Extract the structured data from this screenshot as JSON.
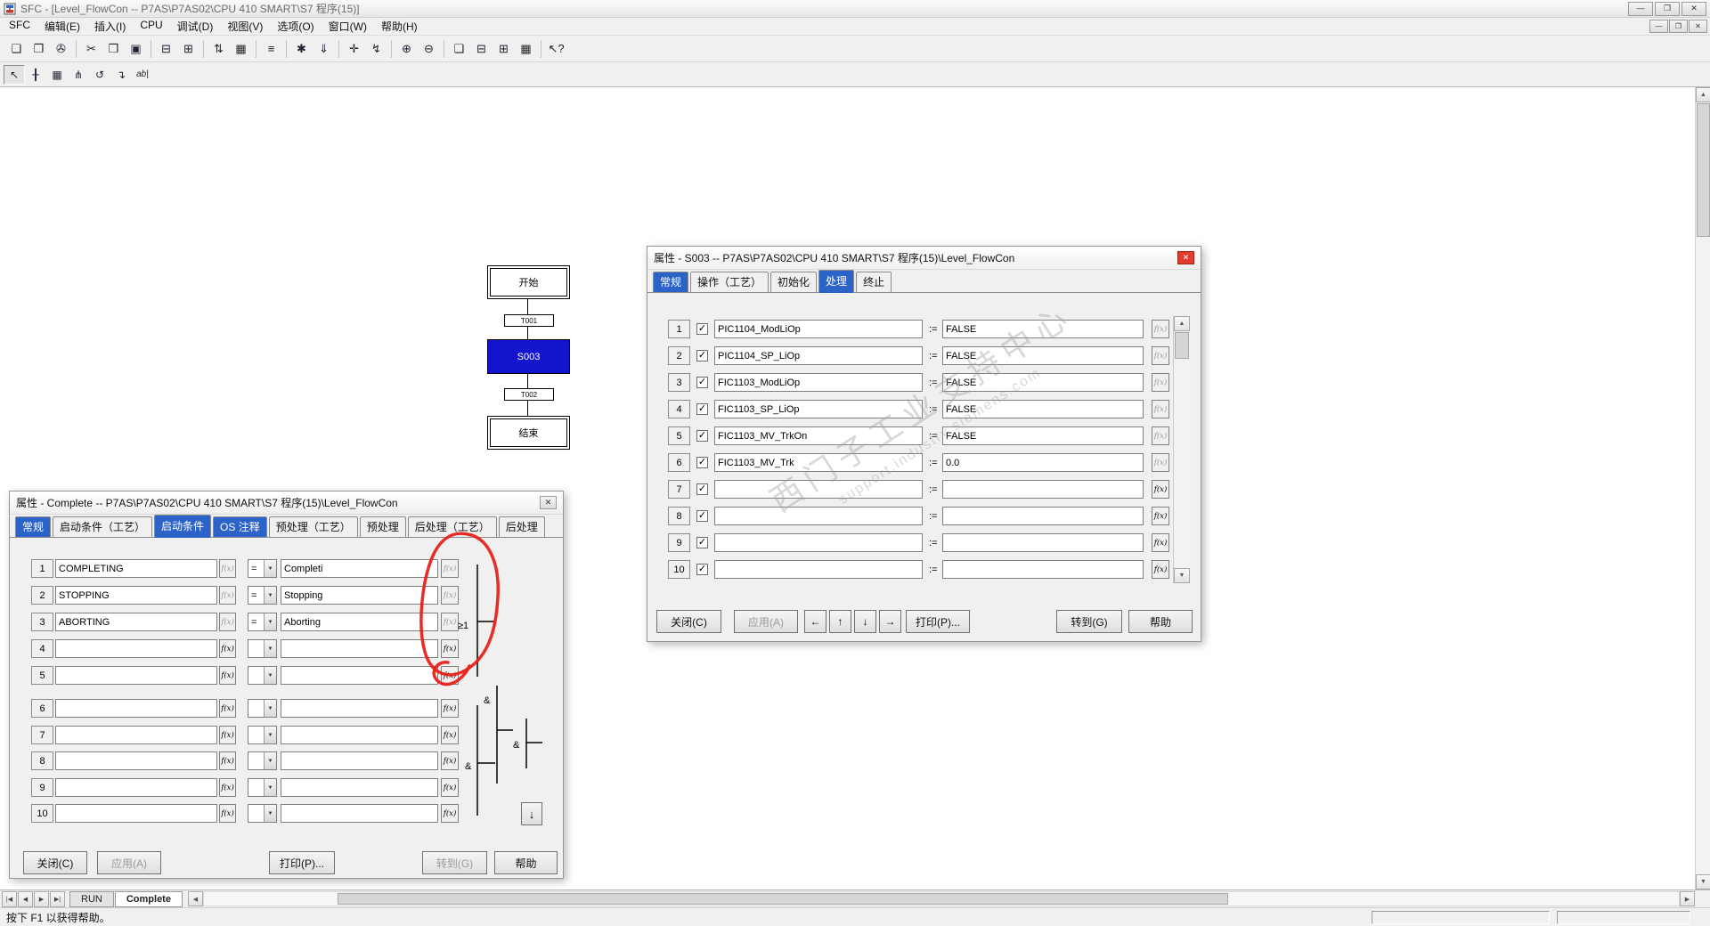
{
  "colors": {
    "tab_blue": "#2b63c8",
    "step_selected_blue": "#1414cf",
    "annotation_red": "#e8211a",
    "close_red": "#e23c2e"
  },
  "glyphs": {
    "close": "✕",
    "minimize": "—",
    "maximize": "❐",
    "restore": "❐",
    "check": "✓",
    "combo_arrow": "▼",
    "up": "▲",
    "down": "▼",
    "left": "◀",
    "right": "▶"
  },
  "titlebar": {
    "title": "SFC - [Level_FlowCon -- P7AS\\P7AS02\\CPU 410 SMART\\S7 程序(15)]"
  },
  "menubar": {
    "items": [
      "SFC",
      "编辑(E)",
      "插入(I)",
      "CPU",
      "调试(D)",
      "视图(V)",
      "选项(O)",
      "窗口(W)",
      "帮助(H)"
    ]
  },
  "toolbar": [
    {
      "name": "new-icon",
      "glyph": "❏"
    },
    {
      "name": "open-icon",
      "glyph": "❐"
    },
    {
      "name": "print-icon",
      "glyph": "✇"
    },
    {
      "sep": true
    },
    {
      "name": "cut-icon",
      "glyph": "✂"
    },
    {
      "name": "copy-icon",
      "glyph": "❒"
    },
    {
      "name": "paste-icon",
      "glyph": "▣"
    },
    {
      "sep": true
    },
    {
      "name": "sheet-view-icon",
      "glyph": "⊟"
    },
    {
      "name": "overview-icon",
      "glyph": "⊞"
    },
    {
      "sep": true
    },
    {
      "name": "run-sequence-icon",
      "glyph": "⇅"
    },
    {
      "name": "chart-icon",
      "glyph": "▦"
    },
    {
      "sep": true
    },
    {
      "name": "catalog-icon",
      "glyph": "≡"
    },
    {
      "sep": true
    },
    {
      "name": "compile-icon",
      "glyph": "✱"
    },
    {
      "name": "download-icon",
      "glyph": "⇓"
    },
    {
      "sep": true
    },
    {
      "name": "crosshair-icon",
      "glyph": "✛"
    },
    {
      "name": "test-mode-icon",
      "glyph": "↯"
    },
    {
      "sep": true
    },
    {
      "name": "zoom-in-icon",
      "glyph": "⊕"
    },
    {
      "name": "zoom-out-icon",
      "glyph": "⊖"
    },
    {
      "sep": true
    },
    {
      "name": "cascade-windows-icon",
      "glyph": "❏"
    },
    {
      "name": "tile-horizontal-icon",
      "glyph": "⊟"
    },
    {
      "name": "tile-vertical-icon",
      "glyph": "⊞"
    },
    {
      "name": "arrange-icons-icon",
      "glyph": "▦"
    },
    {
      "sep": true
    },
    {
      "name": "context-help-icon",
      "glyph": "↖?"
    }
  ],
  "sfc_toolbar": [
    {
      "name": "select-tool-icon",
      "glyph": "↖",
      "pressed": true
    },
    {
      "name": "insert-step-transition-icon",
      "glyph": "╂"
    },
    {
      "name": "insert-simultaneous-branch-icon",
      "glyph": "▦"
    },
    {
      "name": "insert-alternative-branch-icon",
      "glyph": "⋔"
    },
    {
      "name": "insert-loop-icon",
      "glyph": "↺"
    },
    {
      "name": "insert-jump-icon",
      "glyph": "↴"
    },
    {
      "name": "text-tool-icon",
      "glyph": "ab|"
    }
  ],
  "chart": {
    "start": "开始",
    "transition1": "T001",
    "step": "S003",
    "transition2": "T002",
    "end": "结束"
  },
  "fx_label": "f(x)",
  "transition_dialog": {
    "title": "属性 -  Complete -- P7AS\\P7AS02\\CPU 410 SMART\\S7 程序(15)\\Level_FlowCon",
    "tabs": [
      {
        "label": "常规",
        "style": "blue"
      },
      {
        "label": "启动条件（工艺）",
        "style": "plain"
      },
      {
        "label": "启动条件",
        "style": "active"
      },
      {
        "label": "OS 注释",
        "style": "blue"
      },
      {
        "label": "预处理（工艺）",
        "style": "plain"
      },
      {
        "label": "预处理",
        "style": "plain"
      },
      {
        "label": "后处理（工艺）",
        "style": "plain"
      },
      {
        "label": "后处理",
        "style": "plain"
      }
    ],
    "rows": [
      {
        "num": "1",
        "left": "COMPLETING",
        "op": "=",
        "right": "Completi"
      },
      {
        "num": "2",
        "left": "STOPPING",
        "op": "=",
        "right": "Stopping"
      },
      {
        "num": "3",
        "left": "ABORTING",
        "op": "=",
        "right": "Aborting"
      },
      {
        "num": "4",
        "left": "",
        "op": "",
        "right": ""
      },
      {
        "num": "5",
        "left": "",
        "op": "",
        "right": ""
      },
      {
        "num": "6",
        "left": "",
        "op": "",
        "right": ""
      },
      {
        "num": "7",
        "left": "",
        "op": "",
        "right": ""
      },
      {
        "num": "8",
        "left": "",
        "op": "",
        "right": ""
      },
      {
        "num": "9",
        "left": "",
        "op": "",
        "right": ""
      },
      {
        "num": "10",
        "left": "",
        "op": "",
        "right": ""
      }
    ],
    "gates": {
      "or": "≥1",
      "and1": "&",
      "and2": "&",
      "and3": "&",
      "result_arrow": "↓"
    },
    "buttons": {
      "close": "关闭(C)",
      "apply": "应用(A)",
      "print": "打印(P)...",
      "goto": "转到(G)",
      "help": "帮助"
    }
  },
  "step_dialog": {
    "title": "属性 -  S003 -- P7AS\\P7AS02\\CPU 410 SMART\\S7 程序(15)\\Level_FlowCon",
    "tabs": [
      {
        "label": "常规",
        "style": "blue"
      },
      {
        "label": "操作（工艺）",
        "style": "plain"
      },
      {
        "label": "初始化",
        "style": "plain"
      },
      {
        "label": "处理",
        "style": "active"
      },
      {
        "label": "终止",
        "style": "plain"
      }
    ],
    "assign_op": ":=",
    "rows": [
      {
        "num": "1",
        "checked": true,
        "left": "PIC1104_ModLiOp",
        "right": "FALSE"
      },
      {
        "num": "2",
        "checked": true,
        "left": "PIC1104_SP_LiOp",
        "right": "FALSE"
      },
      {
        "num": "3",
        "checked": true,
        "left": "FIC1103_ModLiOp",
        "right": "FALSE"
      },
      {
        "num": "4",
        "checked": true,
        "left": "FIC1103_SP_LiOp",
        "right": "FALSE"
      },
      {
        "num": "5",
        "checked": true,
        "left": "FIC1103_MV_TrkOn",
        "right": "FALSE"
      },
      {
        "num": "6",
        "checked": true,
        "left": "FIC1103_MV_Trk",
        "right": "0.0"
      },
      {
        "num": "7",
        "checked": true,
        "left": "",
        "right": ""
      },
      {
        "num": "8",
        "checked": true,
        "left": "",
        "right": ""
      },
      {
        "num": "9",
        "checked": true,
        "left": "",
        "right": ""
      },
      {
        "num": "10",
        "checked": true,
        "left": "",
        "right": ""
      }
    ],
    "nav_buttons": [
      "←",
      "↑",
      "↓",
      "→"
    ],
    "buttons": {
      "close": "关闭(C)",
      "apply": "应用(A)",
      "print": "打印(P)...",
      "goto": "转到(G)",
      "help": "帮助"
    }
  },
  "sheetbar": {
    "nav": [
      "|◀",
      "◀",
      "▶",
      "▶|"
    ],
    "tabs": [
      {
        "label": "RUN",
        "active": false
      },
      {
        "label": "Complete",
        "active": true
      }
    ]
  },
  "statusbar": {
    "help_text": "按下 F1 以获得帮助。"
  },
  "watermark": {
    "line1": "西门子工业支持中心",
    "line2": "support.industry.siemens.com"
  }
}
